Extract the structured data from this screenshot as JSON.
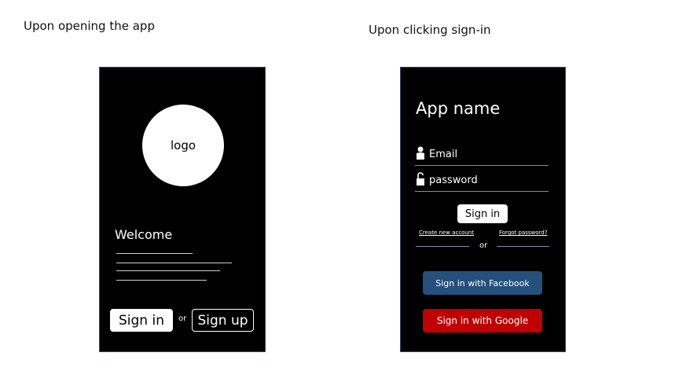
{
  "captions": {
    "left": "Upon opening the app",
    "right": "Upon clicking sign-in"
  },
  "left_screen": {
    "logo_label": "logo",
    "welcome": "Welcome",
    "signin_label": "Sign in",
    "or_label": "or",
    "signup_label": "Sign up"
  },
  "right_screen": {
    "app_name": "App name",
    "email_placeholder": "Email",
    "password_placeholder": "password",
    "signin_label": "Sign in",
    "create_account_label": "Create new account",
    "forgot_password_label": "Forgot password?",
    "or_label": "or",
    "facebook_label": "Sign in with Facebook",
    "google_label": "Sign in with Google",
    "icons": {
      "email": "user-icon",
      "password": "unlock-icon"
    }
  },
  "colors": {
    "screen_bg": "#000000",
    "facebook": "#25507c",
    "google": "#c00000",
    "field_underline": "#7a8fb0"
  }
}
